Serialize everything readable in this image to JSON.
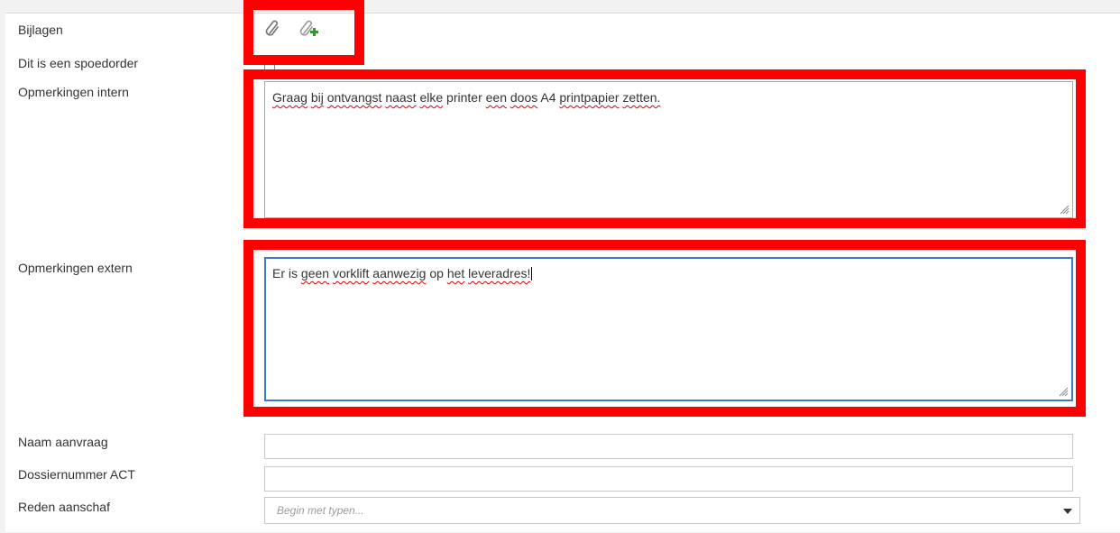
{
  "form": {
    "fields": {
      "bijlagen": "Bijlagen",
      "spoedorder": "Dit is een spoedorder",
      "opmerkingen_intern": "Opmerkingen intern",
      "opmerkingen_extern": "Opmerkingen extern",
      "naam_aanvraag": "Naam aanvraag",
      "dossiernummer": "Dossiernummer ACT",
      "reden_aanschaf": "Reden aanschaf"
    },
    "attachments": {
      "attach_icon": "paperclip-icon",
      "add_icon": "add-attachment-icon"
    },
    "spoedorder_checked": false,
    "intern_words": [
      {
        "t": "Graag",
        "err": true
      },
      {
        "t": "bij",
        "err": true
      },
      {
        "t": "ontvangst",
        "err": true
      },
      {
        "t": "naast",
        "err": true
      },
      {
        "t": "elke",
        "err": true
      },
      {
        "t": "printer",
        "err": false
      },
      {
        "t": "een",
        "err": true
      },
      {
        "t": "doos",
        "err": true
      },
      {
        "t": "A4",
        "err": false
      },
      {
        "t": "printpapier",
        "err": true
      },
      {
        "t": "zetten.",
        "err": true
      }
    ],
    "extern_words": [
      {
        "t": "Er",
        "err": false
      },
      {
        "t": "is",
        "err": false
      },
      {
        "t": "geen",
        "err": true
      },
      {
        "t": "vorklift",
        "err": true
      },
      {
        "t": "aanwezig",
        "err": true
      },
      {
        "t": "op",
        "err": false
      },
      {
        "t": "het",
        "err": true
      },
      {
        "t": "leveradres!",
        "err": true
      }
    ],
    "naam_aanvraag_value": "",
    "dossiernummer_value": "",
    "reden_placeholder": "Begin met typen..."
  },
  "colors": {
    "highlight": "#ff0000",
    "focus_border": "#3a78c9",
    "spellcheck": "#e00000"
  }
}
